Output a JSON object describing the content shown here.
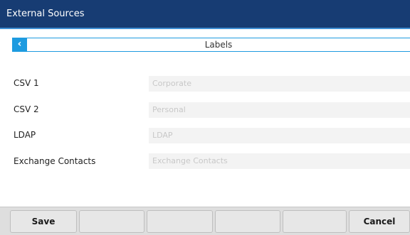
{
  "window": {
    "title": "External Sources"
  },
  "nav": {
    "back_icon": "chevron-left-icon",
    "back_glyph": "‹",
    "title": "Labels"
  },
  "fields": [
    {
      "label": "CSV 1",
      "placeholder": "Corporate"
    },
    {
      "label": "CSV 2",
      "placeholder": "Personal"
    },
    {
      "label": "LDAP",
      "placeholder": "LDAP"
    },
    {
      "label": "Exchange Contacts",
      "placeholder": "Exchange Contacts"
    }
  ],
  "softkeys": [
    {
      "label": "Save"
    },
    {
      "label": ""
    },
    {
      "label": ""
    },
    {
      "label": ""
    },
    {
      "label": ""
    },
    {
      "label": "Cancel"
    }
  ],
  "colors": {
    "titlebar": "#173c73",
    "accent": "#1e9be0"
  }
}
